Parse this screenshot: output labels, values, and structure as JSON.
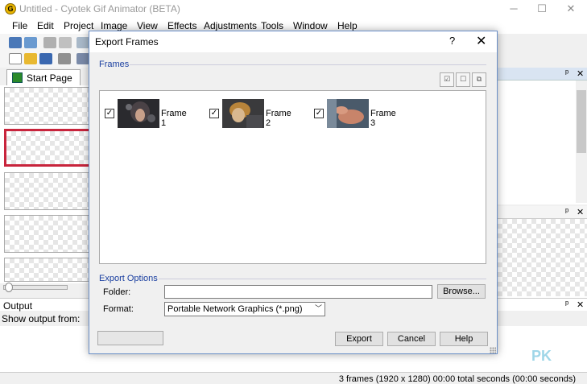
{
  "window": {
    "title": "Untitled - Cyotek Gif Animator (BETA)",
    "controls": {
      "minimize": "─",
      "maximize": "☐",
      "close": "✕"
    }
  },
  "menu": [
    "File",
    "Edit",
    "Project",
    "Image",
    "View",
    "Effects",
    "Adjustments",
    "Tools",
    "Window",
    "Help"
  ],
  "tabs": {
    "start_page": "Start Page"
  },
  "output": {
    "title": "Output",
    "show_from_label": "Show output from:"
  },
  "status": {
    "text": "3 frames (1920 x 1280)  00:00 total seconds (00:00 seconds)"
  },
  "panes": {
    "pin": "ᵖ",
    "close": "✕"
  },
  "watermark": "PK",
  "dialog": {
    "title": "Export Frames",
    "help_glyph": "?",
    "close_glyph": "✕",
    "frames_group": "Frames",
    "select_tools": [
      "check-all",
      "uncheck-all",
      "invert"
    ],
    "frames": [
      {
        "label": "Frame 1",
        "checked": true
      },
      {
        "label": "Frame 2",
        "checked": true
      },
      {
        "label": "Frame 3",
        "checked": true
      }
    ],
    "export_options_group": "Export Options",
    "folder_label": "Folder:",
    "folder_value": "",
    "browse_label": "Browse...",
    "format_label": "Format:",
    "format_value": "Portable Network Graphics (*.png)",
    "export_label": "Export",
    "cancel_label": "Cancel",
    "help_label": "Help"
  },
  "colors": {
    "accent_blue": "#1a3fa0",
    "selected_frame_border": "#c8243c"
  }
}
